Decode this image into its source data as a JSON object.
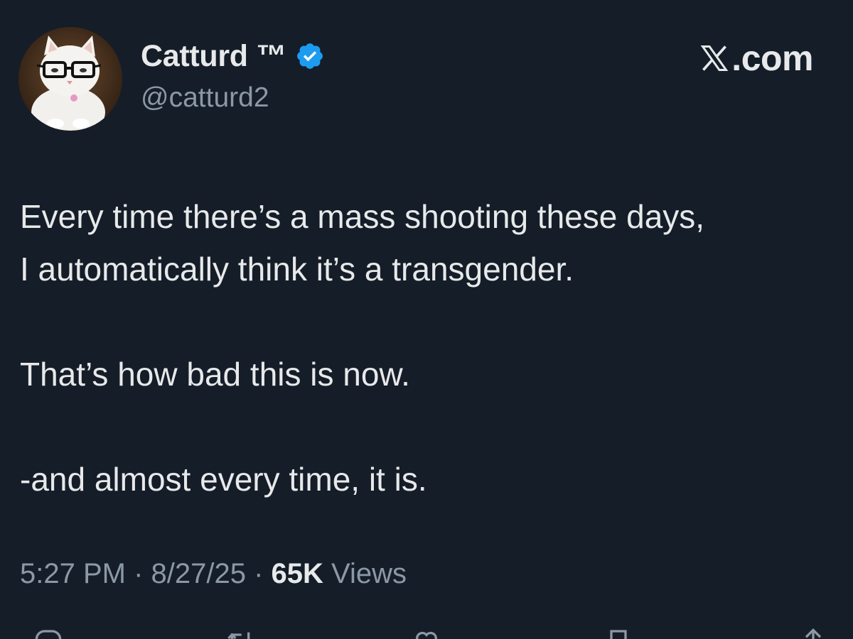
{
  "author": {
    "display_name": "Catturd ™",
    "handle": "@catturd2",
    "verified": true,
    "avatar_icon": "cat-with-glasses-avatar"
  },
  "site": {
    "logo_icon": "x-logo-icon",
    "domain": ".com"
  },
  "tweet": {
    "paragraphs": [
      "Every time there’s a mass shooting these days,",
      "I automatically think it’s a transgender.",
      "That’s how bad this is now.",
      "-and almost every time, it is."
    ]
  },
  "meta": {
    "time": "5:27 PM",
    "date": "8/27/25",
    "separator": " · ",
    "views_count": "65K",
    "views_label": " Views"
  },
  "actions": [
    {
      "name": "reply-icon"
    },
    {
      "name": "repost-icon"
    },
    {
      "name": "like-icon"
    },
    {
      "name": "bookmark-icon"
    },
    {
      "name": "share-icon"
    }
  ],
  "colors": {
    "background": "#151d28",
    "text_primary": "#e7e9ea",
    "text_secondary": "#8b98a5",
    "verified_blue": "#1d9bf0"
  }
}
